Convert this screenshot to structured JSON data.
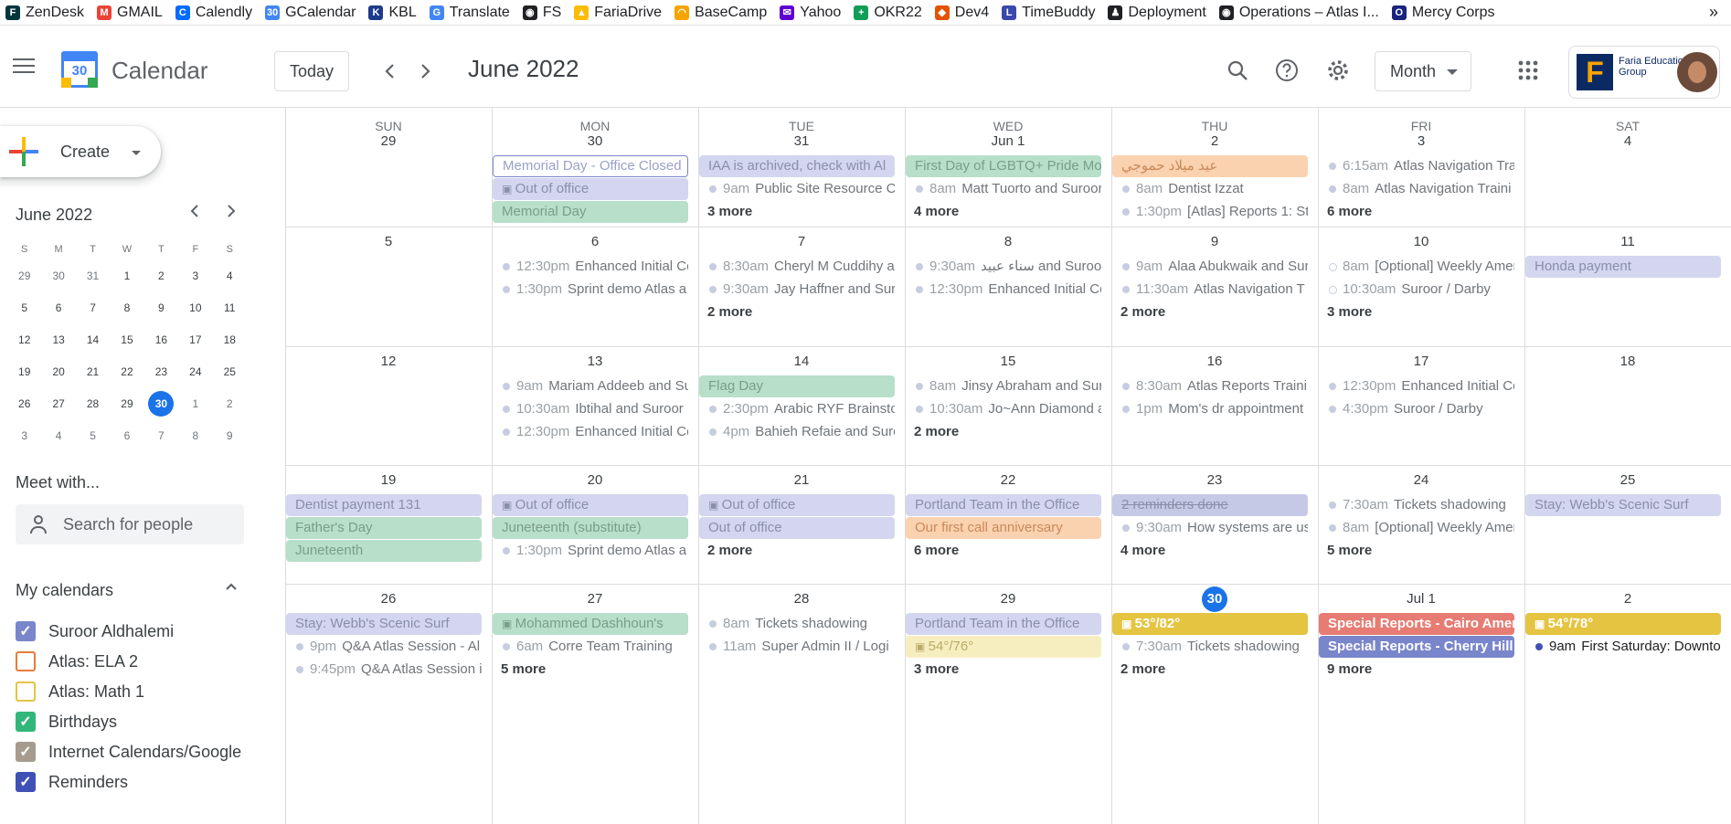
{
  "bookmarks": [
    {
      "label": "ZenDesk",
      "icon": "zendesk-icon",
      "color": "#03363d",
      "glyph": "F"
    },
    {
      "label": "GMAIL",
      "icon": "gmail-icon",
      "color": "#ea4335",
      "glyph": "M"
    },
    {
      "label": "Calendly",
      "icon": "calendly-icon",
      "color": "#006bff",
      "glyph": "C"
    },
    {
      "label": "GCalendar",
      "icon": "gcalendar-icon",
      "color": "#4285f4",
      "glyph": "30"
    },
    {
      "label": "KBL",
      "icon": "kbl-icon",
      "color": "#1e3a8a",
      "glyph": "K"
    },
    {
      "label": "Translate",
      "icon": "translate-icon",
      "color": "#4285f4",
      "glyph": "G"
    },
    {
      "label": "FS",
      "icon": "fs-icon",
      "color": "#202124",
      "glyph": "◉"
    },
    {
      "label": "FariaDrive",
      "icon": "drive-icon",
      "color": "#fbbc04",
      "glyph": "▲"
    },
    {
      "label": "BaseCamp",
      "icon": "basecamp-icon",
      "color": "#f5a400",
      "glyph": "◠"
    },
    {
      "label": "Yahoo",
      "icon": "yahoo-icon",
      "color": "#6001d2",
      "glyph": "✉"
    },
    {
      "label": "OKR22",
      "icon": "sheets-icon",
      "color": "#0f9d58",
      "glyph": "+"
    },
    {
      "label": "Dev4",
      "icon": "dev4-icon",
      "color": "#e65100",
      "glyph": "◆"
    },
    {
      "label": "TimeBuddy",
      "icon": "timebuddy-icon",
      "color": "#3949ab",
      "glyph": "L"
    },
    {
      "label": "Deployment",
      "icon": "deployment-icon",
      "color": "#202124",
      "glyph": "♟"
    },
    {
      "label": "Operations – Atlas I...",
      "icon": "operations-icon",
      "color": "#202124",
      "glyph": "◉"
    },
    {
      "label": "Mercy Corps",
      "icon": "mercycorps-icon",
      "color": "#1a237e",
      "glyph": "O"
    }
  ],
  "bookmarks_more": "»",
  "header": {
    "app_title": "Calendar",
    "logo_number": "30",
    "today_label": "Today",
    "prev_label": "‹",
    "next_label": "›",
    "current_period": "June 2022",
    "view_label": "Month",
    "apps_icon": "apps-grid-icon",
    "org_name": "Faria Education Group",
    "org_initial": "F"
  },
  "sidebar": {
    "create_label": "Create",
    "mini_calendar": {
      "title": "June 2022",
      "weekday_labels": [
        "S",
        "M",
        "T",
        "W",
        "T",
        "F",
        "S"
      ],
      "weeks": [
        [
          "29",
          "30",
          "31",
          "1",
          "2",
          "3",
          "4"
        ],
        [
          "5",
          "6",
          "7",
          "8",
          "9",
          "10",
          "11"
        ],
        [
          "12",
          "13",
          "14",
          "15",
          "16",
          "17",
          "18"
        ],
        [
          "19",
          "20",
          "21",
          "22",
          "23",
          "24",
          "25"
        ],
        [
          "26",
          "27",
          "28",
          "29",
          "30",
          "1",
          "2"
        ],
        [
          "3",
          "4",
          "5",
          "6",
          "7",
          "8",
          "9"
        ]
      ],
      "today": "30"
    },
    "meet_title": "Meet with...",
    "search_placeholder": "Search for people",
    "my_calendars_title": "My calendars",
    "calendars": [
      {
        "label": "Suroor Aldhalemi",
        "color": "#7986cb",
        "checked": true
      },
      {
        "label": "Atlas: ELA 2",
        "color": "#e67c39",
        "checked": false
      },
      {
        "label": "Atlas: Math 1",
        "color": "#e4c441",
        "checked": false
      },
      {
        "label": "Birthdays",
        "color": "#33b679",
        "checked": true
      },
      {
        "label": "Internet Calendars/Google",
        "color": "#a79b8e",
        "checked": true
      },
      {
        "label": "Reminders",
        "color": "#3f51b5",
        "checked": true
      }
    ]
  },
  "month": {
    "weekdays": [
      "SUN",
      "MON",
      "TUE",
      "WED",
      "THU",
      "FRI",
      "SAT"
    ],
    "weeks": [
      {
        "days": [
          {
            "num": "29",
            "events": []
          },
          {
            "num": "30",
            "events": [
              {
                "kind": "outline",
                "text": "Memorial Day - Office Closed",
                "color": "#7986cb"
              },
              {
                "kind": "allday",
                "text": "Out of office",
                "color": "#d3d6ee",
                "icon": true
              },
              {
                "kind": "allday",
                "text": "Memorial Day",
                "color": "#b7dfc9"
              }
            ]
          },
          {
            "num": "31",
            "events": [
              {
                "kind": "allday",
                "text": "IAA is archived, check with Al",
                "color": "#d3d6ee"
              },
              {
                "kind": "timed",
                "time": "9am",
                "text": "Public Site Resource C"
              }
            ],
            "more": "3 more"
          },
          {
            "num": "Jun 1",
            "events": [
              {
                "kind": "allday",
                "text": "First Day of LGBTQ+ Pride Mo",
                "color": "#b7dfc9"
              },
              {
                "kind": "timed",
                "time": "8am",
                "text": "Matt Tuorto and Suroor"
              }
            ],
            "more": "4 more"
          },
          {
            "num": "2",
            "events": [
              {
                "kind": "allday",
                "text": "عيد ميلاد حموجي",
                "color": "#fad2b0"
              },
              {
                "kind": "timed",
                "time": "8am",
                "text": "Dentist Izzat"
              },
              {
                "kind": "timed",
                "time": "1:30pm",
                "text": "[Atlas] Reports 1: St"
              }
            ]
          },
          {
            "num": "3",
            "events": [
              {
                "kind": "timed",
                "time": "6:15am",
                "text": "Atlas Navigation Tra"
              },
              {
                "kind": "timed",
                "time": "8am",
                "text": "Atlas Navigation Traini"
              }
            ],
            "more": "6 more"
          },
          {
            "num": "4",
            "events": []
          }
        ]
      },
      {
        "days": [
          {
            "num": "5",
            "events": []
          },
          {
            "num": "6",
            "events": [
              {
                "kind": "timed",
                "time": "12:30pm",
                "text": "Enhanced Initial Co"
              },
              {
                "kind": "timed",
                "time": "1:30pm",
                "text": "Sprint demo Atlas a"
              }
            ]
          },
          {
            "num": "7",
            "events": [
              {
                "kind": "timed",
                "time": "8:30am",
                "text": "Cheryl M Cuddihy ar"
              },
              {
                "kind": "timed",
                "time": "9:30am",
                "text": "Jay Haffner and Sur"
              }
            ],
            "more": "2 more"
          },
          {
            "num": "8",
            "events": [
              {
                "kind": "timed",
                "time": "9:30am",
                "text": "سناء عبيد and Suroor"
              },
              {
                "kind": "timed",
                "time": "12:30pm",
                "text": "Enhanced Initial Co"
              }
            ]
          },
          {
            "num": "9",
            "events": [
              {
                "kind": "timed",
                "time": "9am",
                "text": "Alaa Abukwaik and Sur"
              },
              {
                "kind": "timed",
                "time": "11:30am",
                "text": "Atlas Navigation T"
              }
            ],
            "more": "2 more"
          },
          {
            "num": "10",
            "events": [
              {
                "kind": "timed-hollow",
                "time": "8am",
                "text": "[Optional] Weekly Amer"
              },
              {
                "kind": "timed-hollow",
                "time": "10:30am",
                "text": "Suroor / Darby"
              }
            ],
            "more": "3 more"
          },
          {
            "num": "11",
            "events": [
              {
                "kind": "allday",
                "text": "Honda payment",
                "color": "#d3d6ee"
              }
            ]
          }
        ]
      },
      {
        "days": [
          {
            "num": "12",
            "events": []
          },
          {
            "num": "13",
            "events": [
              {
                "kind": "timed",
                "time": "9am",
                "text": "Mariam Addeeb and Su"
              },
              {
                "kind": "timed",
                "time": "10:30am",
                "text": "Ibtihal and Suroor"
              },
              {
                "kind": "timed",
                "time": "12:30pm",
                "text": "Enhanced Initial Co"
              }
            ]
          },
          {
            "num": "14",
            "events": [
              {
                "kind": "allday",
                "text": "Flag Day",
                "color": "#b7dfc9"
              },
              {
                "kind": "timed",
                "time": "2:30pm",
                "text": "Arabic RYF Brainsto"
              },
              {
                "kind": "timed",
                "time": "4pm",
                "text": "Bahieh Refaie and Suro"
              }
            ]
          },
          {
            "num": "15",
            "events": [
              {
                "kind": "timed",
                "time": "8am",
                "text": "Jinsy Abraham and Sur"
              },
              {
                "kind": "timed",
                "time": "10:30am",
                "text": "Jo~Ann Diamond a"
              }
            ],
            "more": "2 more"
          },
          {
            "num": "16",
            "events": [
              {
                "kind": "timed",
                "time": "8:30am",
                "text": "Atlas Reports Traini"
              },
              {
                "kind": "timed",
                "time": "1pm",
                "text": "Mom's dr appointment"
              }
            ]
          },
          {
            "num": "17",
            "events": [
              {
                "kind": "timed",
                "time": "12:30pm",
                "text": "Enhanced Initial Co"
              },
              {
                "kind": "timed",
                "time": "4:30pm",
                "text": "Suroor / Darby"
              }
            ]
          },
          {
            "num": "18",
            "events": []
          }
        ]
      },
      {
        "days": [
          {
            "num": "19",
            "events": [
              {
                "kind": "allday",
                "text": "Dentist payment 131",
                "color": "#d3d6ee"
              },
              {
                "kind": "allday",
                "text": "Father's Day",
                "color": "#b7dfc9"
              },
              {
                "kind": "allday",
                "text": "Juneteenth",
                "color": "#b7dfc9"
              }
            ]
          },
          {
            "num": "20",
            "events": [
              {
                "kind": "allday",
                "text": "Out of office",
                "color": "#d3d6ee",
                "icon": true
              },
              {
                "kind": "allday",
                "text": "Juneteenth (substitute)",
                "color": "#b7dfc9"
              },
              {
                "kind": "timed",
                "time": "1:30pm",
                "text": "Sprint demo Atlas a"
              }
            ]
          },
          {
            "num": "21",
            "events": [
              {
                "kind": "allday",
                "text": "Out of office",
                "color": "#d3d6ee",
                "icon": true
              },
              {
                "kind": "allday",
                "text": "Out of office",
                "color": "#d3d6ee"
              }
            ],
            "more": "2 more"
          },
          {
            "num": "22",
            "events": [
              {
                "kind": "allday",
                "text": "Portland Team in the Office",
                "color": "#d3d6ee"
              },
              {
                "kind": "allday",
                "text": "Our first call anniversary",
                "color": "#fad2b0"
              }
            ],
            "more": "6 more"
          },
          {
            "num": "23",
            "events": [
              {
                "kind": "allday-strike",
                "text": "2 reminders done",
                "color": "#c5c9e6"
              },
              {
                "kind": "timed",
                "time": "9:30am",
                "text": "How systems are us"
              }
            ],
            "more": "4 more"
          },
          {
            "num": "24",
            "events": [
              {
                "kind": "timed",
                "time": "7:30am",
                "text": "Tickets shadowing"
              },
              {
                "kind": "timed",
                "time": "8am",
                "text": "[Optional] Weekly Amer"
              }
            ],
            "more": "5 more"
          },
          {
            "num": "25",
            "events": [
              {
                "kind": "allday",
                "text": "Stay: Webb's Scenic Surf",
                "color": "#d3d6ee"
              }
            ]
          }
        ]
      },
      {
        "days": [
          {
            "num": "26",
            "events": [
              {
                "kind": "allday",
                "text": "Stay: Webb's Scenic Surf",
                "color": "#d3d6ee"
              },
              {
                "kind": "timed",
                "time": "9pm",
                "text": "Q&A Atlas Session - Al"
              },
              {
                "kind": "timed",
                "time": "9:45pm",
                "text": "Q&A Atlas Session i"
              }
            ]
          },
          {
            "num": "27",
            "events": [
              {
                "kind": "allday",
                "text": "Mohammed Dashhoun's",
                "color": "#b7dfc9",
                "icon": true
              },
              {
                "kind": "timed",
                "time": "6am",
                "text": "Corre Team Training"
              }
            ],
            "more": "5 more"
          },
          {
            "num": "28",
            "events": [
              {
                "kind": "timed",
                "time": "8am",
                "text": "Tickets shadowing"
              },
              {
                "kind": "timed",
                "time": "11am",
                "text": "Super Admin II / Logi"
              }
            ]
          },
          {
            "num": "29",
            "events": [
              {
                "kind": "allday",
                "text": "Portland Team in the Office",
                "color": "#d3d6ee"
              },
              {
                "kind": "allday",
                "text": "54°/76°",
                "color": "#f7eec0",
                "icon": true
              }
            ],
            "more": "3 more"
          },
          {
            "num": "30",
            "today": true,
            "events": [
              {
                "kind": "allday-strong",
                "text": "53°/82°",
                "color": "#e4c441",
                "icon": true
              },
              {
                "kind": "timed",
                "time": "7:30am",
                "text": "Tickets shadowing"
              }
            ],
            "more": "2 more"
          },
          {
            "num": "Jul 1",
            "events": [
              {
                "kind": "allday-strong",
                "text": "Special Reports - Cairo Ameri",
                "color": "#e67c73"
              },
              {
                "kind": "allday-strong",
                "text": "Special Reports - Cherry Hill I",
                "color": "#7986cb"
              }
            ],
            "more": "9 more"
          },
          {
            "num": "2",
            "events": [
              {
                "kind": "allday-strong",
                "text": "54°/78°",
                "color": "#e4c441",
                "icon": true
              },
              {
                "kind": "timed-dark",
                "time": "9am",
                "text": "First Saturday: Downto"
              }
            ]
          }
        ]
      }
    ]
  }
}
